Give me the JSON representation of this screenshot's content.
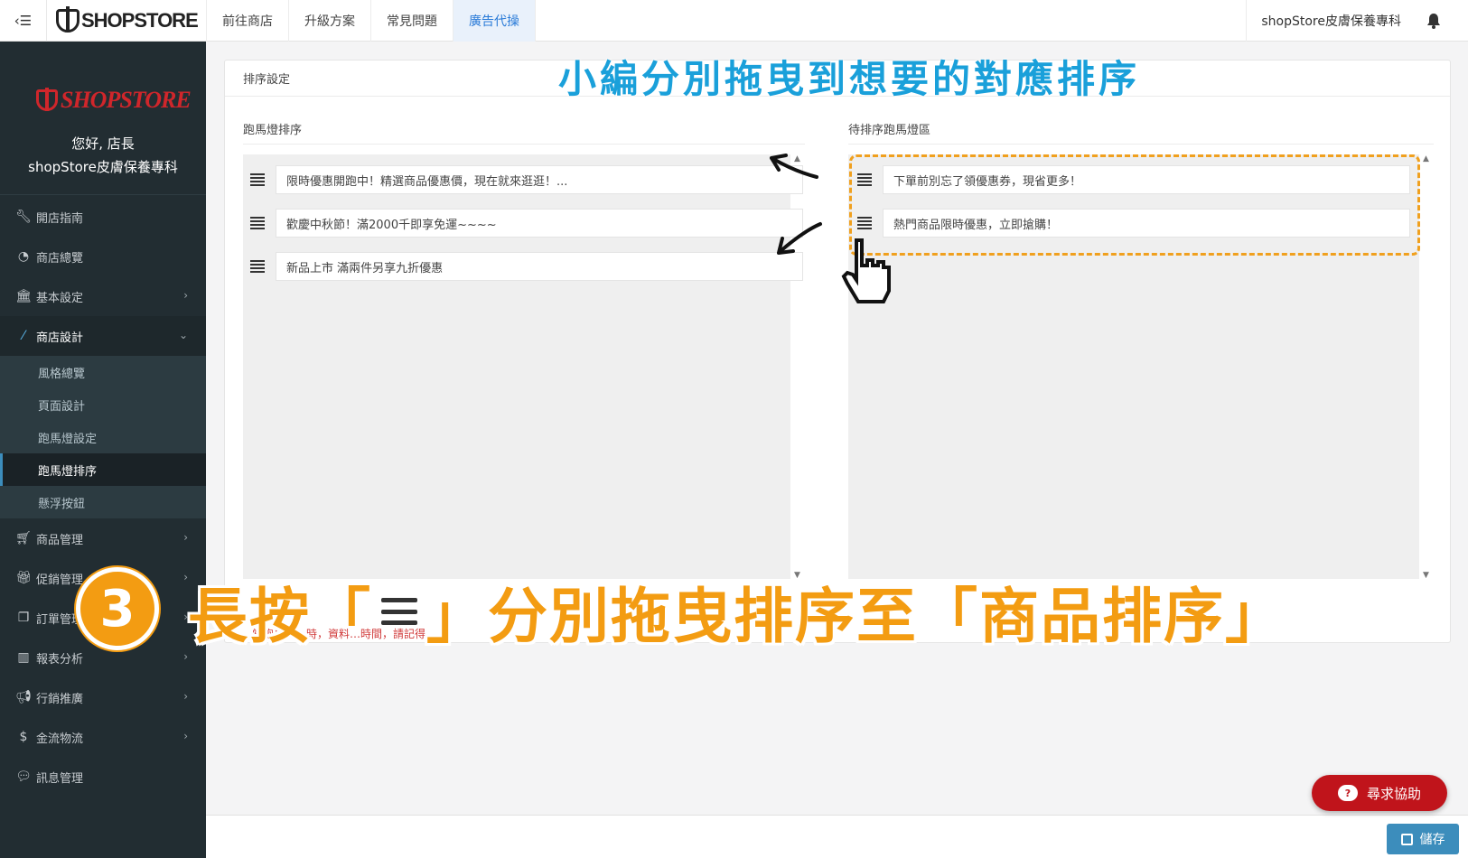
{
  "topbar": {
    "brand": "SHOPSTORE",
    "nav": [
      {
        "label": "前往商店",
        "active": false
      },
      {
        "label": "升級方案",
        "active": false
      },
      {
        "label": "常見問題",
        "active": false
      },
      {
        "label": "廣告代操",
        "active": true
      }
    ],
    "store_name": "shopStore皮膚保養專科"
  },
  "sidebar": {
    "logo": "SHOPSTORE",
    "greeting": "您好, 店長",
    "store_name": "shopStore皮膚保養專科",
    "menu": [
      {
        "label": "開店指南",
        "icon": "wrench-icon",
        "chevron": false
      },
      {
        "label": "商店總覽",
        "icon": "dashboard-icon",
        "chevron": false
      },
      {
        "label": "基本設定",
        "icon": "bank-icon",
        "chevron": true
      },
      {
        "label": "商店設計",
        "icon": "magic-wand-icon",
        "chevron": true,
        "open": true
      }
    ],
    "submenu": [
      {
        "label": "風格總覽"
      },
      {
        "label": "頁面設計"
      },
      {
        "label": "跑馬燈設定"
      },
      {
        "label": "跑馬燈排序",
        "active": true
      },
      {
        "label": "懸浮按鈕"
      }
    ],
    "menu_after": [
      {
        "label": "商品管理",
        "icon": "cart-icon"
      },
      {
        "label": "促銷管理",
        "icon": "gift-icon"
      },
      {
        "label": "訂單管理",
        "icon": "copy-icon"
      },
      {
        "label": "報表分析",
        "icon": "bar-chart-icon"
      },
      {
        "label": "行銷推廣",
        "icon": "bullhorn-icon"
      },
      {
        "label": "金流物流",
        "icon": "dollar-icon"
      },
      {
        "label": "訊息管理",
        "icon": "comments-icon"
      }
    ]
  },
  "panel": {
    "header": "排序設定",
    "left_title": "跑馬燈排序",
    "right_title": "待排序跑馬燈區",
    "left_items": [
      "限時優惠開跑中！精選商品優惠價，現在就來逛逛！...",
      "歡慶中秋節！滿2000千即享免運~~~~",
      "新品上市 滿兩件另享九折優惠"
    ],
    "right_items": [
      "下單前別忘了領優惠券，現省更多！",
      "熱門商品限時優惠，立即搶購！"
    ],
    "note": "當跑馬燈…時，資料…時間，請記得…"
  },
  "annotations": {
    "top_text": "小編分別拖曳到想要的對應排序",
    "step_number": "3",
    "step_text_before": "長按「",
    "step_text_after": "」分別拖曳排序至「商品排序」"
  },
  "help_button": "尋求協助",
  "save_button": "儲存",
  "colors": {
    "sidebar_bg": "#222d32",
    "accent_blue": "#3c8dbc",
    "annotation_orange": "#f39c12",
    "annotation_blue": "#1aa0da",
    "help_red": "#c0141b"
  }
}
